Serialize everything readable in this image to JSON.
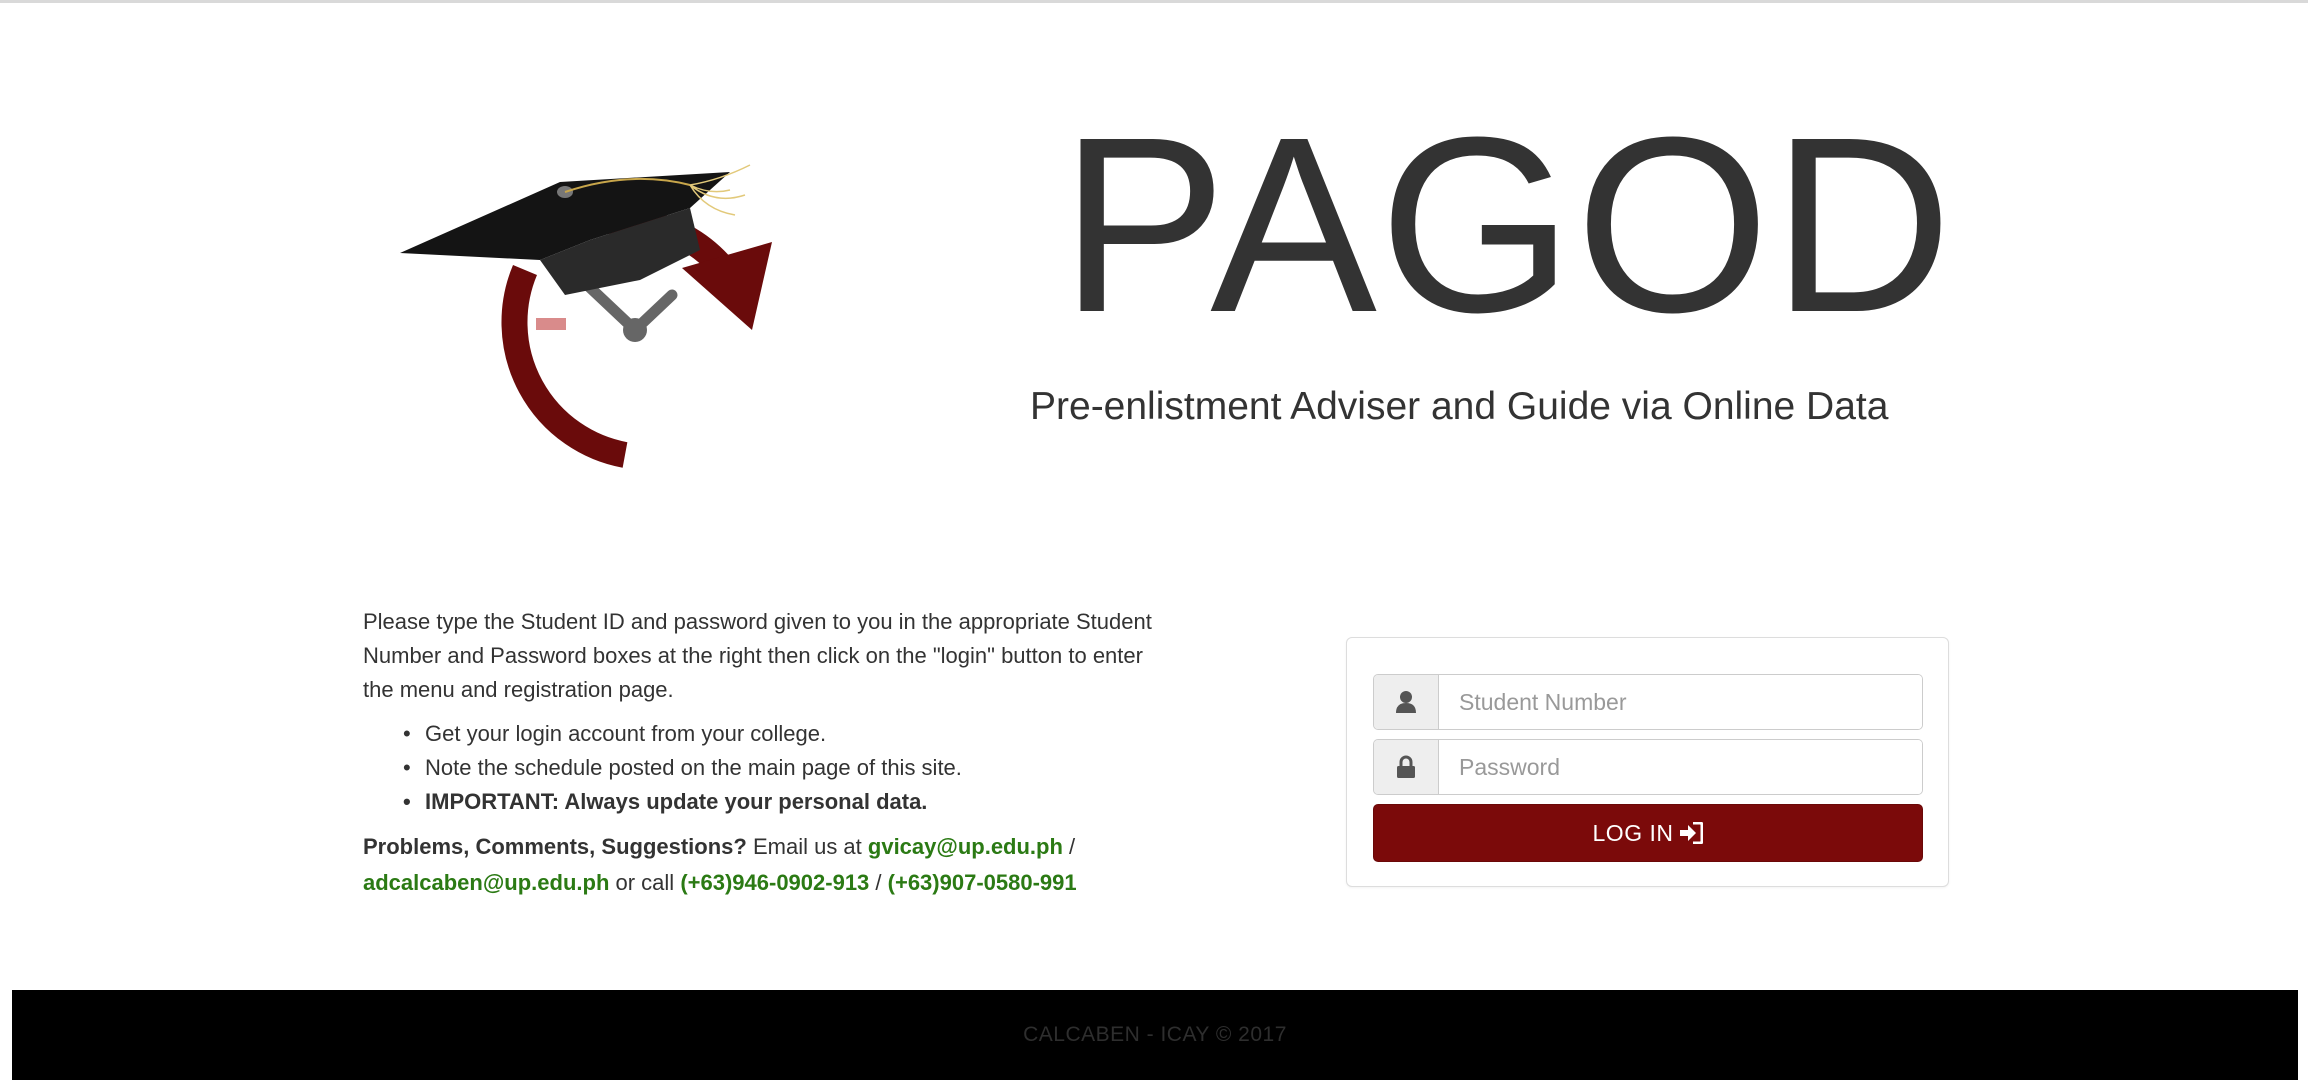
{
  "app": {
    "title": "PAGOD",
    "subtitle": "Pre-enlistment Adviser and Guide via Online Data"
  },
  "instructions": {
    "intro": "Please type the Student ID and password given to you in the appropriate Student Number and Password boxes at the right then click on the \"login\" button to enter the menu and registration page.",
    "bullets": [
      "Get your login account from your college.",
      "Note the schedule posted on the main page of this site.",
      "IMPORTANT: Always update your personal data."
    ],
    "contact": {
      "label": "Problems, Comments, Suggestions?",
      "email_prefix": " Email us at ",
      "email1": "gvicay@up.edu.ph",
      "sep1": " / ",
      "email2": "adcalcaben@up.edu.ph",
      "call_prefix": " or call ",
      "phone1": "(+63)946-0902-913",
      "sep2": " / ",
      "phone2": "(+63)907-0580-991"
    }
  },
  "login": {
    "student_number_placeholder": "Student Number",
    "password_placeholder": "Password",
    "button_label": "LOG IN",
    "user_icon": "user-icon",
    "lock_icon": "lock-icon",
    "login_icon": "sign-in-icon"
  },
  "footer": {
    "text": "CALCABEN - ICAY © 2017"
  },
  "colors": {
    "brand_maroon": "#7b0a0a",
    "link_green": "#2b7a14",
    "footer_bg": "#000000"
  }
}
